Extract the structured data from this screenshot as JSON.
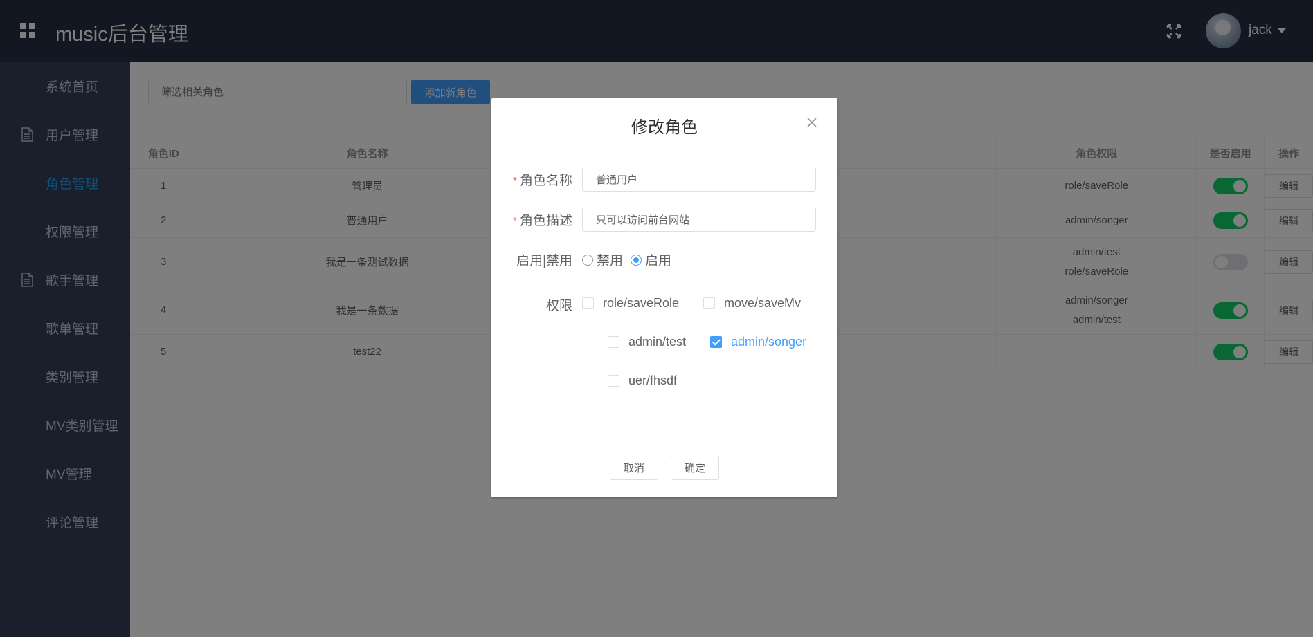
{
  "header": {
    "title": "music后台管理",
    "username": "jack"
  },
  "sidebar": {
    "items": [
      {
        "label": "系统首页",
        "icon": ""
      },
      {
        "label": "用户管理",
        "icon": "document-icon"
      },
      {
        "label": "角色管理",
        "icon": "",
        "active": true
      },
      {
        "label": "权限管理",
        "icon": ""
      },
      {
        "label": "歌手管理",
        "icon": "document-icon"
      },
      {
        "label": "歌单管理",
        "icon": ""
      },
      {
        "label": "类别管理",
        "icon": ""
      },
      {
        "label": "MV类别管理",
        "icon": ""
      },
      {
        "label": "MV管理",
        "icon": ""
      },
      {
        "label": "评论管理",
        "icon": ""
      }
    ]
  },
  "toolbar": {
    "search_placeholder": "筛选相关角色",
    "add_label": "添加新角色"
  },
  "table": {
    "headers": {
      "id": "角色ID",
      "name": "角色名称",
      "perms": "角色权限",
      "enabled": "是否启用",
      "ops": "操作"
    },
    "rows": [
      {
        "id": "1",
        "name": "管理员",
        "perms": [
          "role/saveRole"
        ],
        "enabled": true,
        "edit": "编辑"
      },
      {
        "id": "2",
        "name": "普通用户",
        "perms": [
          "admin/songer"
        ],
        "enabled": true,
        "edit": "编辑"
      },
      {
        "id": "3",
        "name": "我是一条测试数据",
        "perms": [
          "admin/test",
          "role/saveRole"
        ],
        "enabled": false,
        "edit": "编辑"
      },
      {
        "id": "4",
        "name": "我是一条数据",
        "perms": [
          "admin/songer",
          "admin/test"
        ],
        "enabled": true,
        "edit": "编辑"
      },
      {
        "id": "5",
        "name": "test22",
        "perms": [],
        "enabled": true,
        "edit": "编辑"
      }
    ]
  },
  "dialog": {
    "title": "修改角色",
    "name_label": "角色名称",
    "name_value": "普通用户",
    "desc_label": "角色描述",
    "desc_value": "只可以访问前台网站",
    "status_label": "启用|禁用",
    "status_options": [
      "禁用",
      "启用"
    ],
    "status_selected": "启用",
    "perm_label": "权限",
    "permissions": [
      {
        "label": "role/saveRole",
        "checked": false
      },
      {
        "label": "move/saveMv",
        "checked": false
      },
      {
        "label": "admin/test",
        "checked": false
      },
      {
        "label": "admin/songer",
        "checked": true
      },
      {
        "label": "uer/fhsdf",
        "checked": false
      }
    ],
    "cancel_label": "取消",
    "confirm_label": "确定"
  },
  "colors": {
    "header_bg": "#242f42",
    "sidebar_bg": "#324157",
    "accent": "#409eff",
    "switch_on": "#13ce66"
  }
}
